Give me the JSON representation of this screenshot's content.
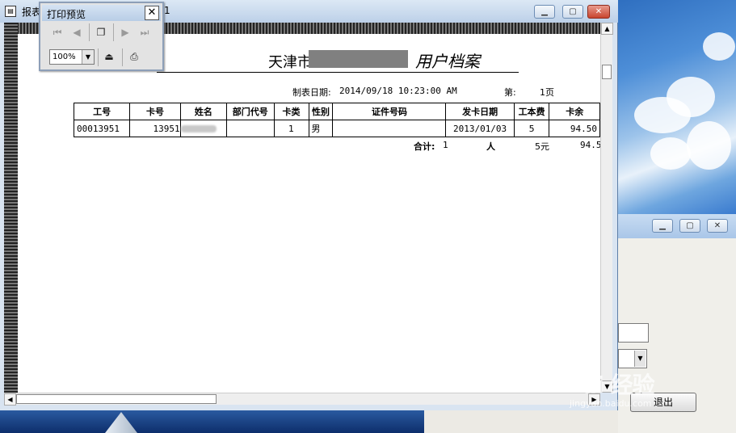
{
  "main_window": {
    "title": "报表",
    "title_suffix": "1"
  },
  "toolbar": {
    "title": "打印预览",
    "zoom": "100%",
    "zoom_arrow": "▼",
    "first_icon": "⏮",
    "prev_icon": "◀",
    "pages_icon": "❐",
    "next_icon": "▶",
    "last_icon": "⏭",
    "exit_icon": "⏏",
    "print_icon": "⎙",
    "close": "✕"
  },
  "report": {
    "title_left": "天津市",
    "title_right": "用户档案",
    "date_label": "制表日期:",
    "date_value": "2014/09/18 10:23:00 AM",
    "page_label": "第:",
    "page_value": "1页",
    "columns": [
      "工号",
      "卡号",
      "姓名",
      "部门代号",
      "卡类",
      "性别",
      "证件号码",
      "发卡日期",
      "工本费",
      "卡余"
    ],
    "rows": [
      {
        "emp_no": "00013951",
        "card_no": "13951",
        "name": "",
        "dept": "",
        "card_type": "1",
        "gender": "男",
        "id_no": "",
        "issue_date": "2013/01/03",
        "cost": "5",
        "balance": "94.50"
      }
    ],
    "total_label": "合计:",
    "total_count": "1",
    "total_unit": "人",
    "total_cost": "5元",
    "total_balance": "94.5"
  },
  "side_window": {
    "exit_label": "退出"
  },
  "watermark": {
    "text": "Bai 经验",
    "sub": "jingyan.baidu.com"
  },
  "colors": {
    "titlebar": "#bcd0e8",
    "close_button": "#c8452f",
    "redaction": "#808080"
  }
}
